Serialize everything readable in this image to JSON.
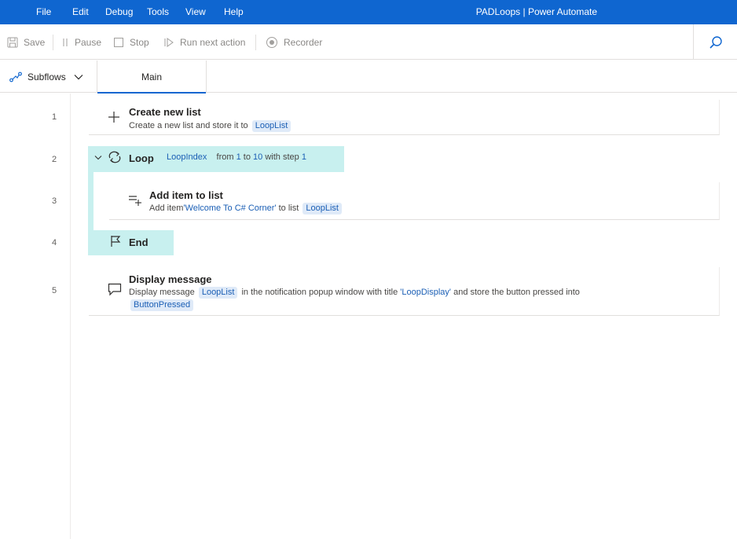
{
  "menu": [
    {
      "label": "File"
    },
    {
      "label": "Edit"
    },
    {
      "label": "Debug"
    },
    {
      "label": "Tools"
    },
    {
      "label": "View"
    },
    {
      "label": "Help"
    }
  ],
  "app_title": "PADLoops | Power Automate",
  "toolbar": {
    "save": "Save",
    "pause": "Pause",
    "stop": "Stop",
    "run_next": "Run next action",
    "recorder": "Recorder"
  },
  "tabs": {
    "subflows": "Subflows",
    "main": "Main"
  },
  "actions": [
    {
      "line": "1",
      "title": "Create new list",
      "desc_prefix": "Create a new list and store it to",
      "var": "LoopList"
    },
    {
      "line": "2",
      "title": "Loop",
      "var": "LoopIndex",
      "from_text": "from",
      "from_val": "1",
      "to_text": "to",
      "to_val": "10",
      "step_text": "with step",
      "step_val": "1"
    },
    {
      "line": "3",
      "title": "Add item to list",
      "desc_prefix": "Add item",
      "item_literal": "'Welcome To C# Corner'",
      "desc_mid": "to list",
      "var": "LoopList"
    },
    {
      "line": "4",
      "title": "End"
    },
    {
      "line": "5",
      "title": "Display message",
      "desc_prefix": "Display message",
      "var": "LoopList",
      "desc_mid": "in the notification popup window with title",
      "title_literal": "'LoopDisplay'",
      "desc_end": "and store the button pressed into",
      "var2": "ButtonPressed"
    }
  ],
  "colors": {
    "titlebar": "#0f66d0",
    "loop_highlight": "#c8f0ef",
    "variable_bg": "#dfeaf8",
    "variable_text": "#1b5fb5"
  }
}
